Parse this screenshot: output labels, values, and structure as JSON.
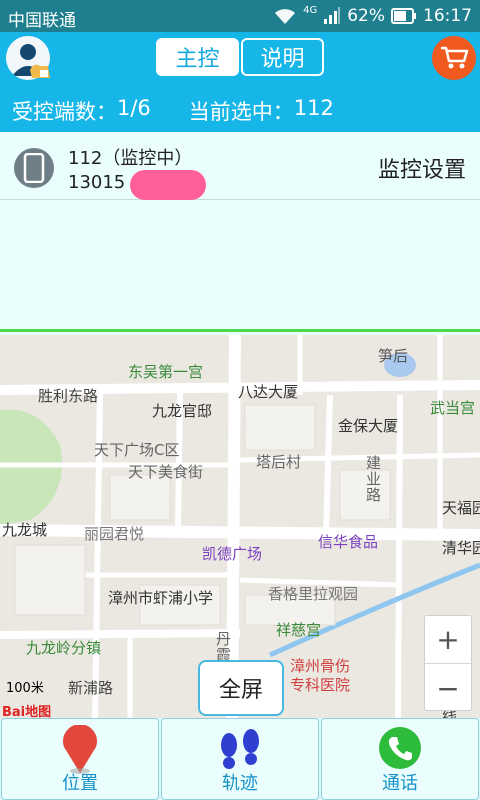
{
  "status_bar": {
    "carrier": "中国联通",
    "network": "4G",
    "battery": "62%",
    "time": "16:17"
  },
  "header": {
    "tabs": [
      {
        "label": "主控",
        "active": true
      },
      {
        "label": "说明",
        "active": false
      }
    ],
    "controlled_count_label": "受控端数：",
    "controlled_count_value": "1/6",
    "selected_label": "当前选中：",
    "selected_value": "112"
  },
  "device": {
    "name": "112（监控中）",
    "phone": "13015",
    "settings_label": "监控设置"
  },
  "map": {
    "labels": [
      "东吴第一宫",
      "八达大厦",
      "笋后",
      "胜利东路",
      "九龙官邸",
      "金保大厦",
      "武当宫",
      "天下广场C区",
      "天下美食街",
      "塔后村",
      "建业路",
      "天福园",
      "九龙城",
      "丽园君悦",
      "凯德广场",
      "信华食品",
      "清华园",
      "漳州市虾浦小学",
      "香格里拉观园",
      "祥慈宫",
      "九龙岭分镇",
      "丹霞路",
      "漳州骨伤专科医院",
      "新浦路",
      "线"
    ],
    "hospital_line1": "漳州骨伤",
    "hospital_line2": "专科医院",
    "scale": "100米",
    "logo": "Bai地图",
    "zoom_in": "+",
    "zoom_out": "−",
    "fullscreen_label": "全屏"
  },
  "bottom_bar": [
    {
      "label": "位置",
      "icon": "location-pin-icon"
    },
    {
      "label": "轨迹",
      "icon": "footprints-icon"
    },
    {
      "label": "通话",
      "icon": "phone-call-icon"
    }
  ],
  "colors": {
    "header_bg": "#16b6e8",
    "status_bg": "#1f7f8f",
    "panel_bg": "#eafffd",
    "accent_green": "#4cd84c",
    "cart_orange": "#f05a1e"
  }
}
